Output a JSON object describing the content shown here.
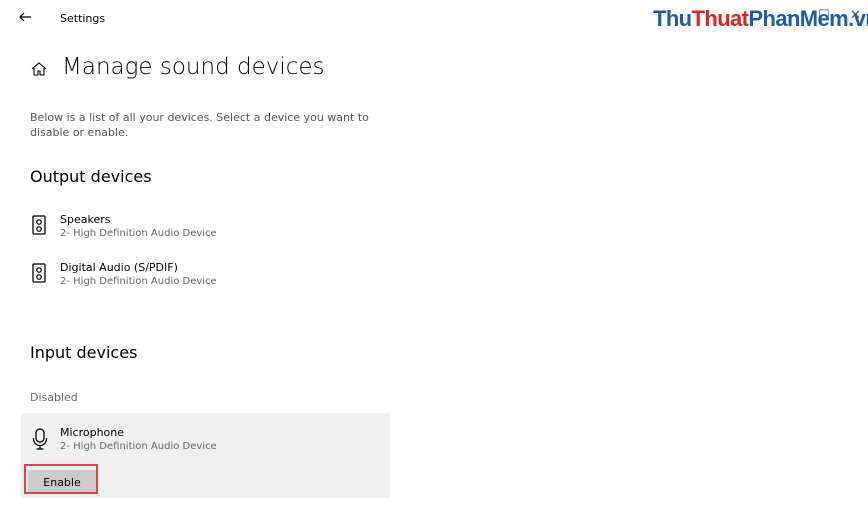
{
  "window": {
    "app_title": "Settings",
    "watermark": {
      "part1": "Thu",
      "part2": "Thuat",
      "part3": "Phan",
      "part4": "Mem.vn"
    },
    "controls": {
      "minimize": "—",
      "maximize": "☐",
      "close": "✕"
    }
  },
  "header": {
    "title": "Manage sound devices"
  },
  "description": "Below is a list of all your devices. Select a device you want to disable or enable.",
  "output": {
    "title": "Output devices",
    "devices": [
      {
        "name": "Speakers",
        "subtitle": "2- High Definition Audio Device",
        "icon": "speaker-icon"
      },
      {
        "name": "Digital Audio (S/PDIF)",
        "subtitle": "2- High Definition Audio Device",
        "icon": "speaker-icon"
      }
    ]
  },
  "input": {
    "title": "Input devices",
    "disabled_label": "Disabled",
    "devices": [
      {
        "name": "Microphone",
        "subtitle": "2- High Definition Audio Device",
        "icon": "microphone-icon",
        "button_label": "Enable"
      }
    ]
  },
  "colors": {
    "highlight": "#e0404a",
    "watermark_blue": "#1b5fa8",
    "watermark_red": "#e02424",
    "panel_bg": "#f0f0f0"
  }
}
